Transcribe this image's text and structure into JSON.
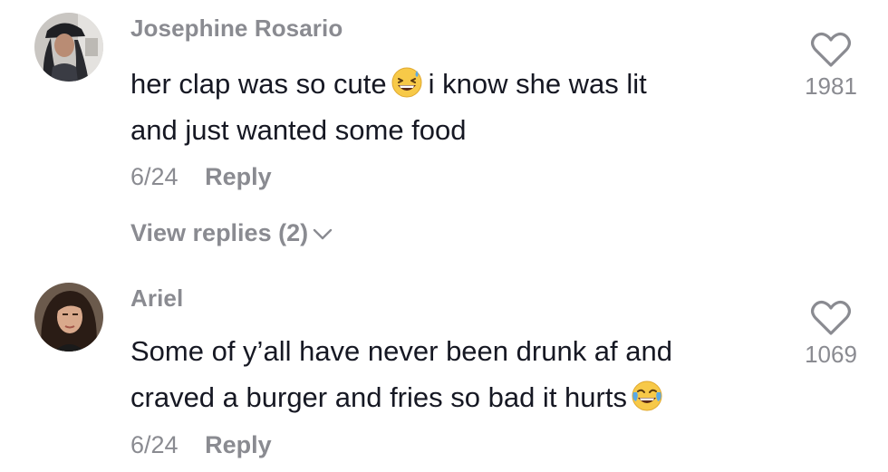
{
  "comments": [
    {
      "username": "Josephine Rosario",
      "text_line1_before_emoji": "her clap was so cute",
      "text_line1_after_emoji": "i know she was lit",
      "text_line2": "and just wanted some food",
      "emoji": "grinning-squinting-face-with-sweat",
      "date": "6/24",
      "reply_label": "Reply",
      "view_replies_label": "View replies (2)",
      "like_count": "1981",
      "avatar": "avatar-photo-person-hat"
    },
    {
      "username": "Ariel",
      "text_line1": "Some of y’all have never been drunk af and",
      "text_line2_before_emoji": "craved a burger and fries so bad it hurts",
      "emoji": "face-with-tears-of-joy",
      "date": "6/24",
      "reply_label": "Reply",
      "like_count": "1069",
      "avatar": "avatar-photo-dark-hair"
    }
  ],
  "colors": {
    "text_primary": "#161823",
    "text_secondary": "#8a8b91",
    "emoji_yellow": "#f7c948",
    "emoji_tears": "#5aa9e6"
  },
  "icons": {
    "like": "heart-outline-icon",
    "expand": "chevron-down-icon"
  }
}
